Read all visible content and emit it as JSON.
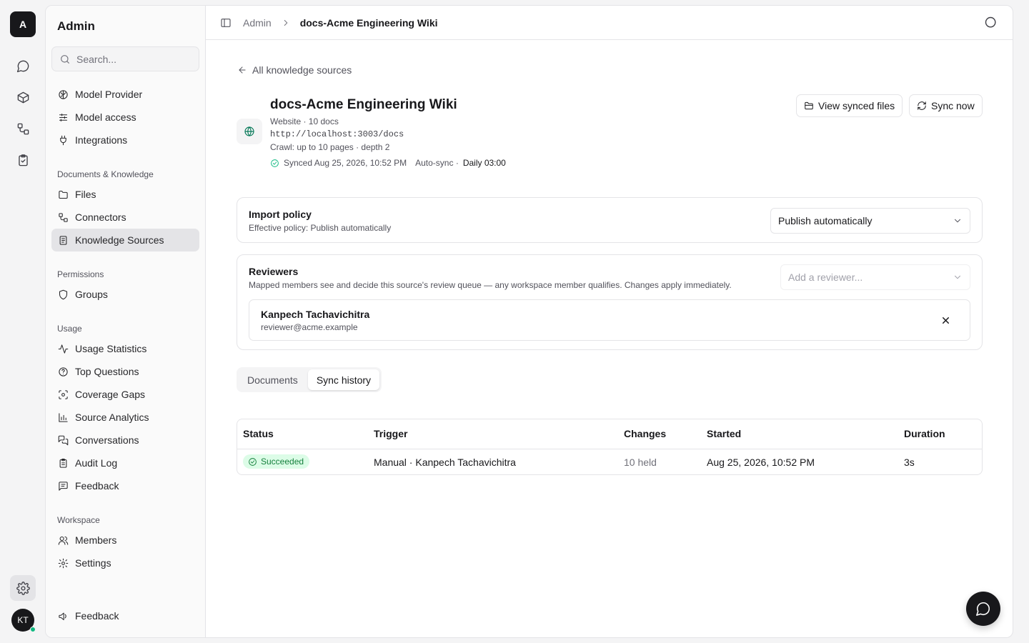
{
  "rail": {
    "workspace_initial": "A",
    "avatar_initials": "KT"
  },
  "sidebar": {
    "title": "Admin",
    "search_placeholder": "Search...",
    "items_top": [
      {
        "label": "Model Provider",
        "icon": "brain-icon"
      },
      {
        "label": "Model access",
        "icon": "sliders-icon"
      },
      {
        "label": "Integrations",
        "icon": "plug-icon"
      }
    ],
    "group_docs": "Documents & Knowledge",
    "items_docs": [
      {
        "label": "Files",
        "icon": "folder-icon"
      },
      {
        "label": "Connectors",
        "icon": "connector-icon"
      },
      {
        "label": "Knowledge Sources",
        "icon": "book-icon",
        "active": true
      }
    ],
    "group_perm": "Permissions",
    "items_perm": [
      {
        "label": "Groups",
        "icon": "shield-icon"
      }
    ],
    "group_usage": "Usage",
    "items_usage": [
      {
        "label": "Usage Statistics",
        "icon": "activity-icon"
      },
      {
        "label": "Top Questions",
        "icon": "help-circle-icon"
      },
      {
        "label": "Coverage Gaps",
        "icon": "scan-icon"
      },
      {
        "label": "Source Analytics",
        "icon": "bar-chart-icon"
      },
      {
        "label": "Conversations",
        "icon": "messages-icon"
      },
      {
        "label": "Audit Log",
        "icon": "clipboard-icon"
      },
      {
        "label": "Feedback",
        "icon": "message-square-icon"
      }
    ],
    "group_ws": "Workspace",
    "items_ws": [
      {
        "label": "Members",
        "icon": "users-icon"
      },
      {
        "label": "Settings",
        "icon": "gear-icon"
      }
    ],
    "footer_feedback": "Feedback"
  },
  "breadcrumb": {
    "root": "Admin",
    "current": "docs-Acme Engineering Wiki"
  },
  "source": {
    "back_label": "All knowledge sources",
    "title": "docs-Acme Engineering Wiki",
    "type_line": "Website · 10 docs",
    "url": "http://localhost:3003/docs",
    "crawl": "Crawl: up to 10 pages · depth 2",
    "synced": "Synced Aug 25, 2026, 10:52 PM",
    "autosync_label": "Auto-sync ·",
    "autosync_value": "Daily 03:00",
    "btn_view": "View synced files",
    "btn_sync": "Sync now"
  },
  "import_policy": {
    "title": "Import policy",
    "subtitle": "Effective policy: Publish automatically",
    "selected": "Publish automatically"
  },
  "reviewers": {
    "title": "Reviewers",
    "subtitle": "Mapped members see and decide this source's review queue — any workspace member qualifies. Changes apply immediately.",
    "add_placeholder": "Add a reviewer...",
    "list": [
      {
        "name": "Kanpech Tachavichitra",
        "email": "reviewer@acme.example"
      }
    ]
  },
  "tabs": [
    {
      "label": "Documents"
    },
    {
      "label": "Sync history",
      "selected": true
    }
  ],
  "table": {
    "headers": [
      "Status",
      "Trigger",
      "Changes",
      "Started",
      "Duration"
    ],
    "rows": [
      {
        "status": "Succeeded",
        "trigger": "Manual · Kanpech Tachavichitra",
        "changes": "10 held",
        "started": "Aug 25, 2026, 10:52 PM",
        "duration": "3s"
      }
    ]
  },
  "colors": {
    "accent": "#18181b",
    "success": "#10b981",
    "success_bg": "#dcfce7",
    "source_icon": "#047857"
  }
}
